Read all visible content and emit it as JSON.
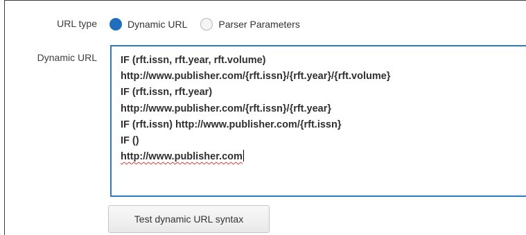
{
  "url_type": {
    "label": "URL type",
    "options": [
      {
        "label": "Dynamic URL",
        "checked": true
      },
      {
        "label": "Parser Parameters",
        "checked": false
      }
    ]
  },
  "dynamic_url": {
    "label": "Dynamic URL",
    "lines": [
      "IF (rft.issn, rft.year, rft.volume)",
      "http://www.publisher.com/{rft.issn}/{rft.year}/{rft.volume}",
      "IF (rft.issn, rft.year)",
      "http://www.publisher.com/{rft.issn}/{rft.year}",
      "IF (rft.issn) http://www.publisher.com/{rft.issn}",
      "IF ()",
      "http://www.publisher.com"
    ]
  },
  "test_button": {
    "label": "Test dynamic URL syntax"
  },
  "colors": {
    "accent": "#1f6fbd",
    "focus_border": "#2c7cc4",
    "spellcheck": "#d23a3a"
  }
}
